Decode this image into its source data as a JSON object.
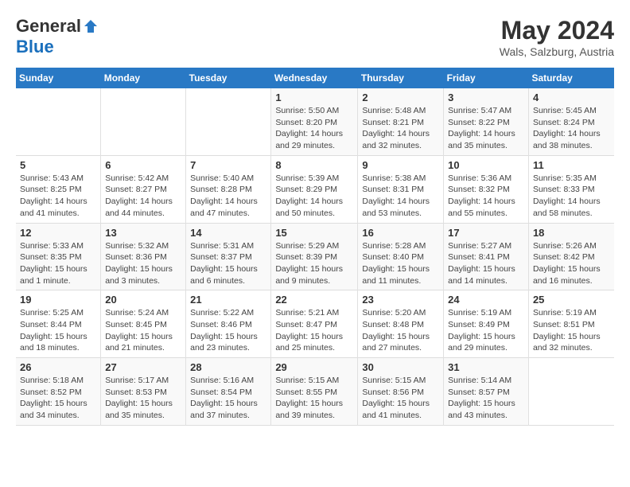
{
  "logo": {
    "general": "General",
    "blue": "Blue"
  },
  "header": {
    "month_year": "May 2024",
    "location": "Wals, Salzburg, Austria"
  },
  "weekdays": [
    "Sunday",
    "Monday",
    "Tuesday",
    "Wednesday",
    "Thursday",
    "Friday",
    "Saturday"
  ],
  "weeks": [
    [
      {
        "day": "",
        "info": ""
      },
      {
        "day": "",
        "info": ""
      },
      {
        "day": "",
        "info": ""
      },
      {
        "day": "1",
        "info": "Sunrise: 5:50 AM\nSunset: 8:20 PM\nDaylight: 14 hours and 29 minutes."
      },
      {
        "day": "2",
        "info": "Sunrise: 5:48 AM\nSunset: 8:21 PM\nDaylight: 14 hours and 32 minutes."
      },
      {
        "day": "3",
        "info": "Sunrise: 5:47 AM\nSunset: 8:22 PM\nDaylight: 14 hours and 35 minutes."
      },
      {
        "day": "4",
        "info": "Sunrise: 5:45 AM\nSunset: 8:24 PM\nDaylight: 14 hours and 38 minutes."
      }
    ],
    [
      {
        "day": "5",
        "info": "Sunrise: 5:43 AM\nSunset: 8:25 PM\nDaylight: 14 hours and 41 minutes."
      },
      {
        "day": "6",
        "info": "Sunrise: 5:42 AM\nSunset: 8:27 PM\nDaylight: 14 hours and 44 minutes."
      },
      {
        "day": "7",
        "info": "Sunrise: 5:40 AM\nSunset: 8:28 PM\nDaylight: 14 hours and 47 minutes."
      },
      {
        "day": "8",
        "info": "Sunrise: 5:39 AM\nSunset: 8:29 PM\nDaylight: 14 hours and 50 minutes."
      },
      {
        "day": "9",
        "info": "Sunrise: 5:38 AM\nSunset: 8:31 PM\nDaylight: 14 hours and 53 minutes."
      },
      {
        "day": "10",
        "info": "Sunrise: 5:36 AM\nSunset: 8:32 PM\nDaylight: 14 hours and 55 minutes."
      },
      {
        "day": "11",
        "info": "Sunrise: 5:35 AM\nSunset: 8:33 PM\nDaylight: 14 hours and 58 minutes."
      }
    ],
    [
      {
        "day": "12",
        "info": "Sunrise: 5:33 AM\nSunset: 8:35 PM\nDaylight: 15 hours and 1 minute."
      },
      {
        "day": "13",
        "info": "Sunrise: 5:32 AM\nSunset: 8:36 PM\nDaylight: 15 hours and 3 minutes."
      },
      {
        "day": "14",
        "info": "Sunrise: 5:31 AM\nSunset: 8:37 PM\nDaylight: 15 hours and 6 minutes."
      },
      {
        "day": "15",
        "info": "Sunrise: 5:29 AM\nSunset: 8:39 PM\nDaylight: 15 hours and 9 minutes."
      },
      {
        "day": "16",
        "info": "Sunrise: 5:28 AM\nSunset: 8:40 PM\nDaylight: 15 hours and 11 minutes."
      },
      {
        "day": "17",
        "info": "Sunrise: 5:27 AM\nSunset: 8:41 PM\nDaylight: 15 hours and 14 minutes."
      },
      {
        "day": "18",
        "info": "Sunrise: 5:26 AM\nSunset: 8:42 PM\nDaylight: 15 hours and 16 minutes."
      }
    ],
    [
      {
        "day": "19",
        "info": "Sunrise: 5:25 AM\nSunset: 8:44 PM\nDaylight: 15 hours and 18 minutes."
      },
      {
        "day": "20",
        "info": "Sunrise: 5:24 AM\nSunset: 8:45 PM\nDaylight: 15 hours and 21 minutes."
      },
      {
        "day": "21",
        "info": "Sunrise: 5:22 AM\nSunset: 8:46 PM\nDaylight: 15 hours and 23 minutes."
      },
      {
        "day": "22",
        "info": "Sunrise: 5:21 AM\nSunset: 8:47 PM\nDaylight: 15 hours and 25 minutes."
      },
      {
        "day": "23",
        "info": "Sunrise: 5:20 AM\nSunset: 8:48 PM\nDaylight: 15 hours and 27 minutes."
      },
      {
        "day": "24",
        "info": "Sunrise: 5:19 AM\nSunset: 8:49 PM\nDaylight: 15 hours and 29 minutes."
      },
      {
        "day": "25",
        "info": "Sunrise: 5:19 AM\nSunset: 8:51 PM\nDaylight: 15 hours and 32 minutes."
      }
    ],
    [
      {
        "day": "26",
        "info": "Sunrise: 5:18 AM\nSunset: 8:52 PM\nDaylight: 15 hours and 34 minutes."
      },
      {
        "day": "27",
        "info": "Sunrise: 5:17 AM\nSunset: 8:53 PM\nDaylight: 15 hours and 35 minutes."
      },
      {
        "day": "28",
        "info": "Sunrise: 5:16 AM\nSunset: 8:54 PM\nDaylight: 15 hours and 37 minutes."
      },
      {
        "day": "29",
        "info": "Sunrise: 5:15 AM\nSunset: 8:55 PM\nDaylight: 15 hours and 39 minutes."
      },
      {
        "day": "30",
        "info": "Sunrise: 5:15 AM\nSunset: 8:56 PM\nDaylight: 15 hours and 41 minutes."
      },
      {
        "day": "31",
        "info": "Sunrise: 5:14 AM\nSunset: 8:57 PM\nDaylight: 15 hours and 43 minutes."
      },
      {
        "day": "",
        "info": ""
      }
    ]
  ]
}
